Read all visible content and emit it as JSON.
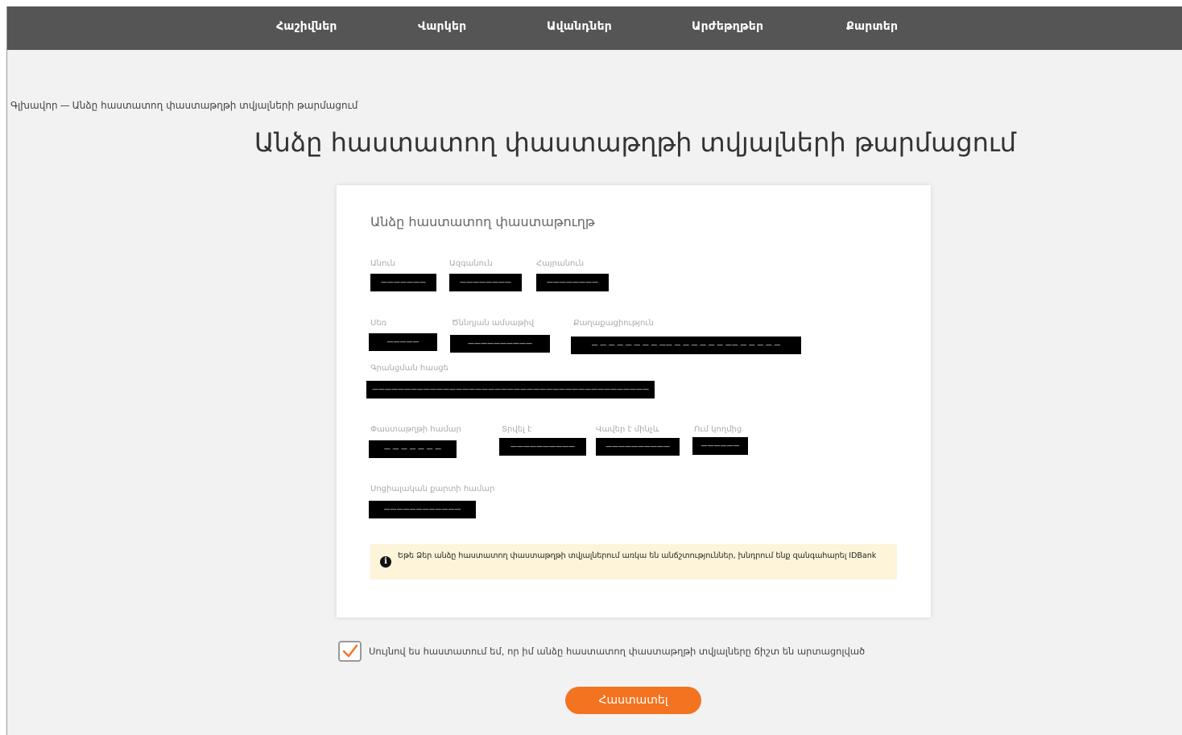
{
  "nav": {
    "items": [
      "Հաշիվներ",
      "Վարկեր",
      "Ավանդներ",
      "Արժեթղթեր",
      "Քարտեր"
    ]
  },
  "breadcrumb": {
    "home": "Գլխավոր",
    "separator": "—",
    "current": "Անձը հաստատող փաստաթղթի տվյալների թարմացում"
  },
  "page_title": "Անձը հաստատող փաստաթղթի տվյալների թարմացում",
  "card": {
    "title": "Անձը հաստատող փաստաթուղթ",
    "fields": {
      "first_name": {
        "label": "Անուն",
        "value": "———————"
      },
      "last_name": {
        "label": "Ազգանուն",
        "value": "————————"
      },
      "patronymic": {
        "label": "Հայրանուն",
        "value": "————————"
      },
      "gender": {
        "label": "Սեռ",
        "value": "—————"
      },
      "birth_date": {
        "label": "Ծննդյան ամսաթիվ",
        "value": "——————————"
      },
      "citizenship": {
        "label": "Քաղաքացիություն",
        "value": "— — — — — — — — —— — — — — — — —— — — — — —"
      },
      "registration_address": {
        "label": "Գրանցման հասցե",
        "value": "———————————————————————————————————————————"
      },
      "document_number": {
        "label": "Փաստաթղթի համար",
        "value": "— — — — — — —"
      },
      "issued_date": {
        "label": "Տրվել է",
        "value": "——————————"
      },
      "valid_until": {
        "label": "Վավեր է մինչև",
        "value": "——————————"
      },
      "issued_by": {
        "label": "Ում կողմից",
        "value": "——————"
      },
      "social_card_number": {
        "label": "Սոցիալական քարտի համար",
        "value": "————————————"
      }
    },
    "notice": {
      "icon": "info-icon",
      "text": "Եթե Ձեր անձը հաստատող փաստաթղթի տվյալներում առկա են անճշտություններ, խնդրում ենք զանգահարել IDBank"
    }
  },
  "consent": {
    "checked": true,
    "text": "Սույնով ես հաստատում եմ, որ իմ անձը հաստատող փաստաթղթի տվյալները ճիշտ են արտացոլված"
  },
  "confirm_button": "Հաստատել",
  "colors": {
    "nav_bg": "#555555",
    "accent": "#f47320",
    "notice_bg": "#fdf4d9",
    "check": "#f47320"
  }
}
